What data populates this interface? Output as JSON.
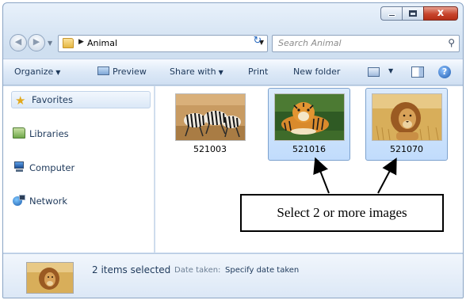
{
  "window": {
    "close_glyph": "x"
  },
  "address": {
    "path": [
      "Animal"
    ],
    "search_placeholder": "Search Animal"
  },
  "toolbar": {
    "organize": "Organize",
    "preview": "Preview",
    "share_with": "Share with",
    "print": "Print",
    "new_folder": "New folder"
  },
  "nav": {
    "favorites": "Favorites",
    "libraries": "Libraries",
    "computer": "Computer",
    "network": "Network"
  },
  "files": [
    {
      "name": "521003",
      "selected": false
    },
    {
      "name": "521016",
      "selected": true
    },
    {
      "name": "521070",
      "selected": true
    }
  ],
  "callout": "Select 2 or more images",
  "details": {
    "count": "2 items selected",
    "date_label": "Date taken:",
    "date_value": "Specify date taken"
  },
  "colors": {
    "selection_bg": "#c1dcfc",
    "selection_border": "#7da2ce",
    "close_red": "#c7442c"
  }
}
